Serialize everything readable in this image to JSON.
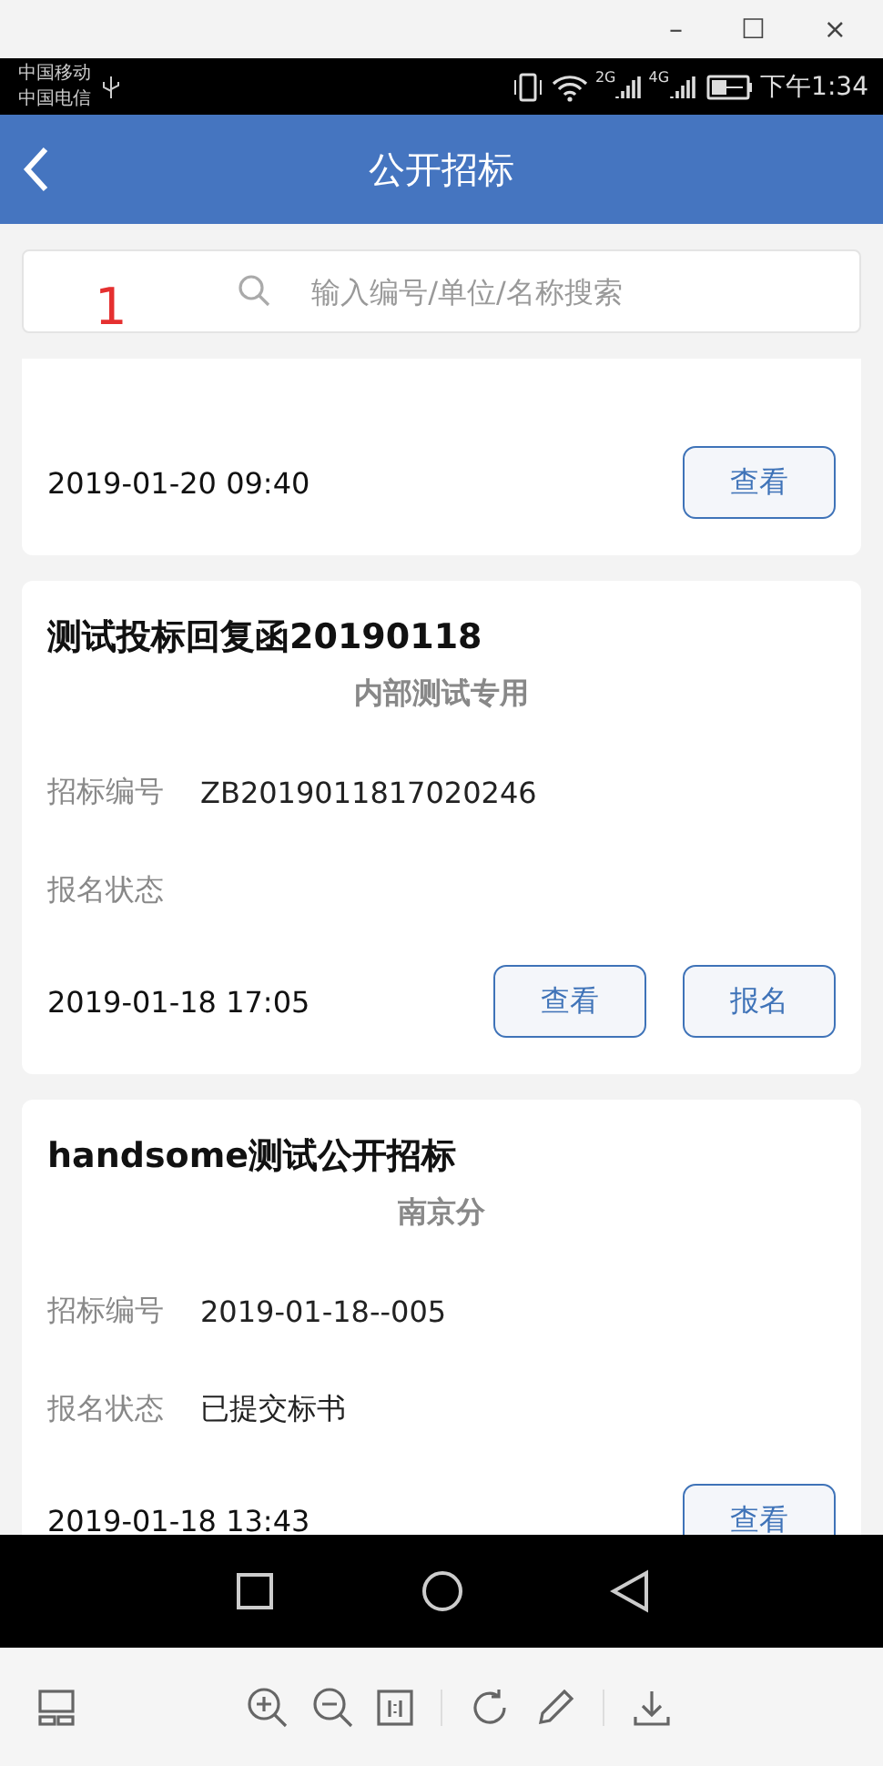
{
  "window_controls": [
    "–",
    "☐",
    "×"
  ],
  "status_bar": {
    "carriers": [
      "中国移动",
      "中国电信"
    ],
    "signal_labels": [
      "2G",
      "4G"
    ],
    "time": "下午1:34"
  },
  "header": {
    "title": "公开招标"
  },
  "search": {
    "placeholder": "输入编号/单位/名称搜索"
  },
  "annotation": "1",
  "cards": [
    {
      "kind": "partial",
      "date": "2019-01-20 09:40",
      "buttons": [
        "查看"
      ]
    },
    {
      "kind": "full",
      "title": "测试投标回复函20190118",
      "subtitle": "内部测试专用",
      "fields": [
        {
          "label": "招标编号",
          "value": "ZB2019011817020246"
        },
        {
          "label": "报名状态"
        }
      ],
      "date": "2019-01-18 17:05",
      "buttons": [
        "查看",
        "报名"
      ]
    },
    {
      "kind": "full",
      "title": "handsome测试公开招标",
      "subtitle": "南京分",
      "fields": [
        {
          "label": "招标编号",
          "value": "2019-01-18--005"
        },
        {
          "label": "报名状态",
          "value": "已提交标书"
        }
      ],
      "date": "2019-01-18 13:43",
      "buttons": [
        "查看"
      ]
    }
  ]
}
